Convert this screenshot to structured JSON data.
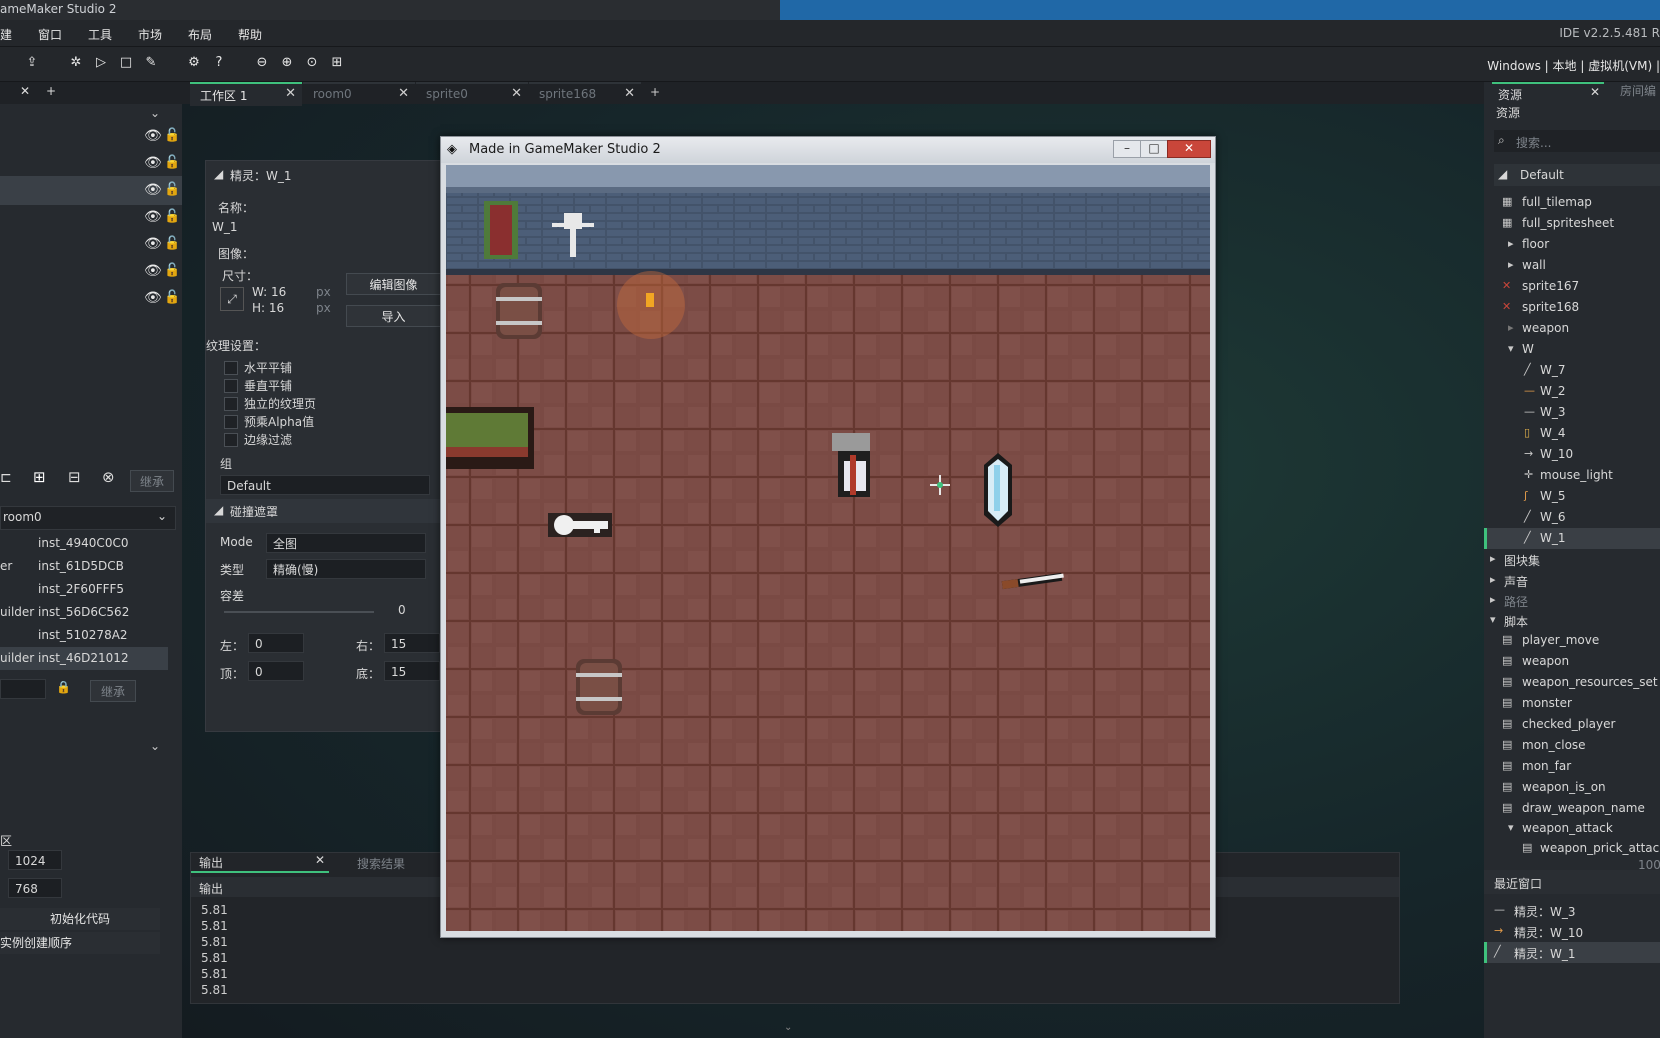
{
  "app": {
    "window_title": "ameMaker Studio 2",
    "ide_version": "IDE v2.2.5.481  R"
  },
  "menu": [
    "建",
    "窗口",
    "工具",
    "市场",
    "布局",
    "帮助"
  ],
  "target": "Windows  |  本地  |  虚拟机(VM)  |",
  "tabs": [
    {
      "label": "工作区 1",
      "active": true
    },
    {
      "label": "room0",
      "active": false
    },
    {
      "label": "sprite0",
      "active": false
    },
    {
      "label": "sprite168",
      "active": false
    }
  ],
  "left": {
    "room_select": "room0",
    "inherit_label": "继承",
    "instances": [
      {
        "prefix": "",
        "name": "inst_4940C0C0"
      },
      {
        "prefix": "er",
        "name": "inst_61D5DCB"
      },
      {
        "prefix": "",
        "name": "inst_2F60FFF5"
      },
      {
        "prefix": "uilder",
        "name": "inst_56D6C562"
      },
      {
        "prefix": "",
        "name": "inst_510278A2"
      },
      {
        "prefix": "uilder",
        "name": "inst_46D21012"
      }
    ],
    "section_label": "区",
    "width": "1024",
    "height": "768",
    "init_code": "初始化代码",
    "creation_order": "实例创建顺序"
  },
  "sprite": {
    "header": "精灵：W_1",
    "name_label": "名称：",
    "name_value": "W_1",
    "image_label": "图像：",
    "size_label": "尺寸：",
    "w": "W: 16",
    "h": "H: 16",
    "px": "px",
    "edit_image": "编辑图像",
    "import": "导入",
    "texture_label": "纹理设置：",
    "options": [
      "水平平铺",
      "垂直平铺",
      "独立的纹理页",
      "预乘Alpha值",
      "边缘过滤"
    ],
    "group_label": "组",
    "group_value": "Default",
    "collision_header": "碰撞遮罩",
    "mode_label": "Mode",
    "mode_value": "全图",
    "type_label": "类型",
    "type_value": "精确(慢)",
    "tolerance_label": "容差",
    "tolerance_value": "0",
    "left_label": "左：",
    "left_value": "0",
    "right_label": "右：",
    "right_value": "15",
    "top_label": "顶：",
    "top_value": "0",
    "bottom_label": "底：",
    "bottom_value": "15"
  },
  "game": {
    "title": "Made in GameMaker Studio 2"
  },
  "output": {
    "tab": "输出",
    "search_tab": "搜索结果",
    "header": "输出",
    "lines": [
      "5.81",
      "5.81",
      "5.81",
      "5.81",
      "5.81",
      "5.81"
    ]
  },
  "resources": {
    "tab": "资源",
    "tab2": "房间编",
    "title": "资源",
    "search_placeholder": "搜索...",
    "default": "Default",
    "items": [
      {
        "name": "full_tilemap",
        "indent": 1,
        "icon": "sprite-icon"
      },
      {
        "name": "full_spritesheet",
        "indent": 1,
        "icon": "sprite-icon"
      },
      {
        "name": "floor",
        "indent": 1,
        "icon": "folder-arrow-icon"
      },
      {
        "name": "wall",
        "indent": 1,
        "icon": "folder-arrow-icon"
      },
      {
        "name": "sprite167",
        "indent": 1,
        "icon": "sprite-icon"
      },
      {
        "name": "sprite168",
        "indent": 1,
        "icon": "sprite-icon"
      },
      {
        "name": "weapon",
        "indent": 1,
        "icon": "folder-arrow-icon"
      },
      {
        "name": "W",
        "indent": 1,
        "icon": "folder-open-icon"
      },
      {
        "name": "W_7",
        "indent": 2,
        "icon": "sprite-icon"
      },
      {
        "name": "W_2",
        "indent": 2,
        "icon": "sprite-icon"
      },
      {
        "name": "W_3",
        "indent": 2,
        "icon": "sprite-icon"
      },
      {
        "name": "W_4",
        "indent": 2,
        "icon": "sprite-icon"
      },
      {
        "name": "W_10",
        "indent": 2,
        "icon": "sprite-icon"
      },
      {
        "name": "mouse_light",
        "indent": 2,
        "icon": "sprite-icon"
      },
      {
        "name": "W_5",
        "indent": 2,
        "icon": "sprite-icon"
      },
      {
        "name": "W_6",
        "indent": 2,
        "icon": "sprite-icon"
      },
      {
        "name": "W_1",
        "indent": 2,
        "icon": "sprite-icon",
        "selected": true
      }
    ],
    "groups": [
      "图块集",
      "声音",
      "路径",
      "脚本"
    ],
    "scripts": [
      "player_move",
      "weapon",
      "weapon_resources_set",
      "monster",
      "checked_player",
      "mon_close",
      "mon_far",
      "weapon_is_on",
      "draw_weapon_name",
      "weapon_attack",
      "weapon_prick_attack"
    ],
    "percent": "100",
    "recent_title": "最近窗口",
    "recent": [
      "精灵：W_3",
      "精灵：W_10",
      "精灵：W_1"
    ]
  },
  "colors": {
    "accent": "#3fc17d",
    "floor": "#7a4a44",
    "wall": "#47566a"
  }
}
